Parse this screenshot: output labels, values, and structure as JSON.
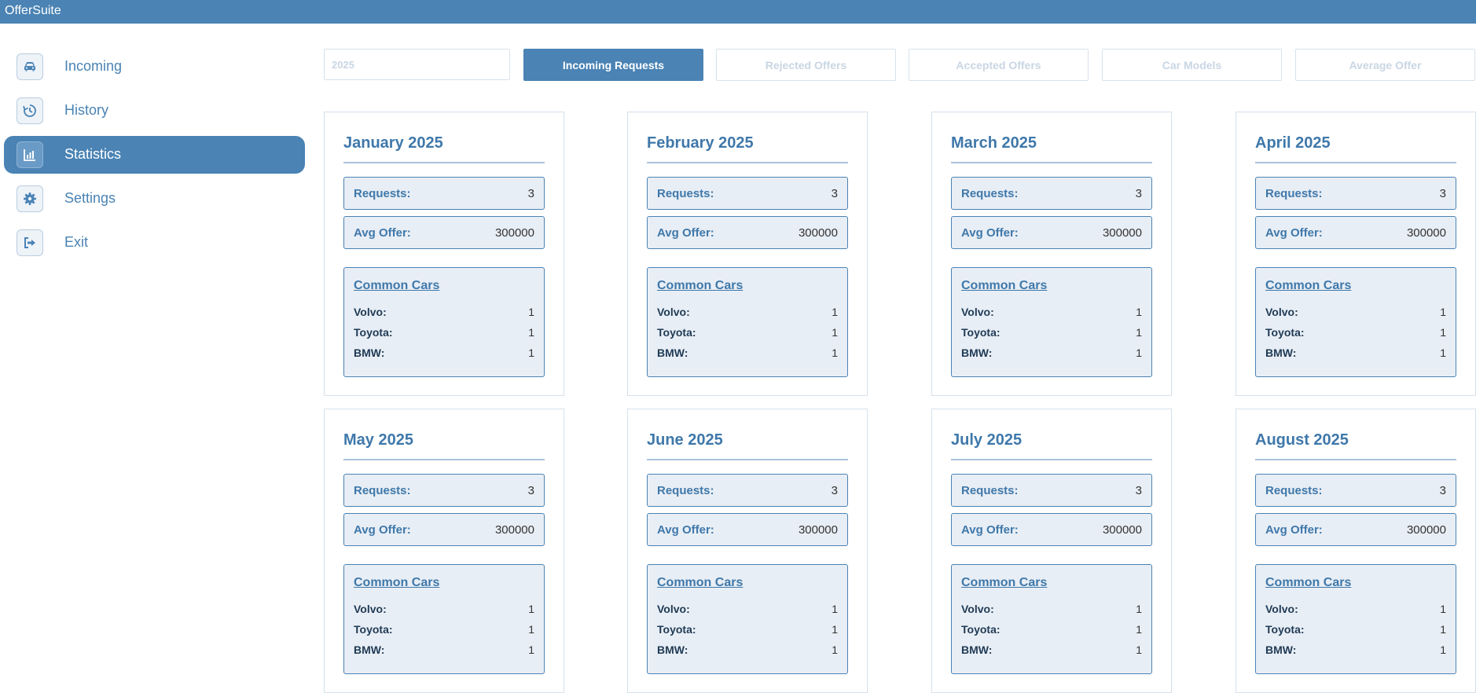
{
  "app": {
    "title": "OfferSuite"
  },
  "sidebar": {
    "items": [
      {
        "label": "Incoming",
        "icon": "car-icon",
        "active": false
      },
      {
        "label": "History",
        "icon": "history-icon",
        "active": false
      },
      {
        "label": "Statistics",
        "icon": "bar-chart-icon",
        "active": true
      },
      {
        "label": "Settings",
        "icon": "gear-icon",
        "active": false
      },
      {
        "label": "Exit",
        "icon": "exit-icon",
        "active": false
      }
    ]
  },
  "toolbar": {
    "year_placeholder": "2025",
    "tabs": [
      {
        "label": "Incoming Requests",
        "active": true
      },
      {
        "label": "Rejected Offers",
        "active": false
      },
      {
        "label": "Accepted Offers",
        "active": false
      },
      {
        "label": "Car Models",
        "active": false
      },
      {
        "label": "Average Offer",
        "active": false
      }
    ]
  },
  "labels": {
    "requests": "Requests:",
    "avg_offer": "Avg Offer:",
    "common_cars": "Common Cars"
  },
  "months": [
    {
      "title": "January 2025",
      "requests": "3",
      "avg_offer": "300000",
      "cars": [
        {
          "name": "Volvo:",
          "count": "1"
        },
        {
          "name": "Toyota:",
          "count": "1"
        },
        {
          "name": "BMW:",
          "count": "1"
        }
      ]
    },
    {
      "title": "February 2025",
      "requests": "3",
      "avg_offer": "300000",
      "cars": [
        {
          "name": "Volvo:",
          "count": "1"
        },
        {
          "name": "Toyota:",
          "count": "1"
        },
        {
          "name": "BMW:",
          "count": "1"
        }
      ]
    },
    {
      "title": "March 2025",
      "requests": "3",
      "avg_offer": "300000",
      "cars": [
        {
          "name": "Volvo:",
          "count": "1"
        },
        {
          "name": "Toyota:",
          "count": "1"
        },
        {
          "name": "BMW:",
          "count": "1"
        }
      ]
    },
    {
      "title": "April 2025",
      "requests": "3",
      "avg_offer": "300000",
      "cars": [
        {
          "name": "Volvo:",
          "count": "1"
        },
        {
          "name": "Toyota:",
          "count": "1"
        },
        {
          "name": "BMW:",
          "count": "1"
        }
      ]
    },
    {
      "title": "May 2025",
      "requests": "3",
      "avg_offer": "300000",
      "cars": [
        {
          "name": "Volvo:",
          "count": "1"
        },
        {
          "name": "Toyota:",
          "count": "1"
        },
        {
          "name": "BMW:",
          "count": "1"
        }
      ]
    },
    {
      "title": "June 2025",
      "requests": "3",
      "avg_offer": "300000",
      "cars": [
        {
          "name": "Volvo:",
          "count": "1"
        },
        {
          "name": "Toyota:",
          "count": "1"
        },
        {
          "name": "BMW:",
          "count": "1"
        }
      ]
    },
    {
      "title": "July 2025",
      "requests": "3",
      "avg_offer": "300000",
      "cars": [
        {
          "name": "Volvo:",
          "count": "1"
        },
        {
          "name": "Toyota:",
          "count": "1"
        },
        {
          "name": "BMW:",
          "count": "1"
        }
      ]
    },
    {
      "title": "August 2025",
      "requests": "3",
      "avg_offer": "300000",
      "cars": [
        {
          "name": "Volvo:",
          "count": "1"
        },
        {
          "name": "Toyota:",
          "count": "1"
        },
        {
          "name": "BMW:",
          "count": "1"
        }
      ]
    }
  ],
  "colors": {
    "accent": "#4a83b4",
    "panel": "#e8eef5",
    "text_dark": "#1f3a55"
  }
}
